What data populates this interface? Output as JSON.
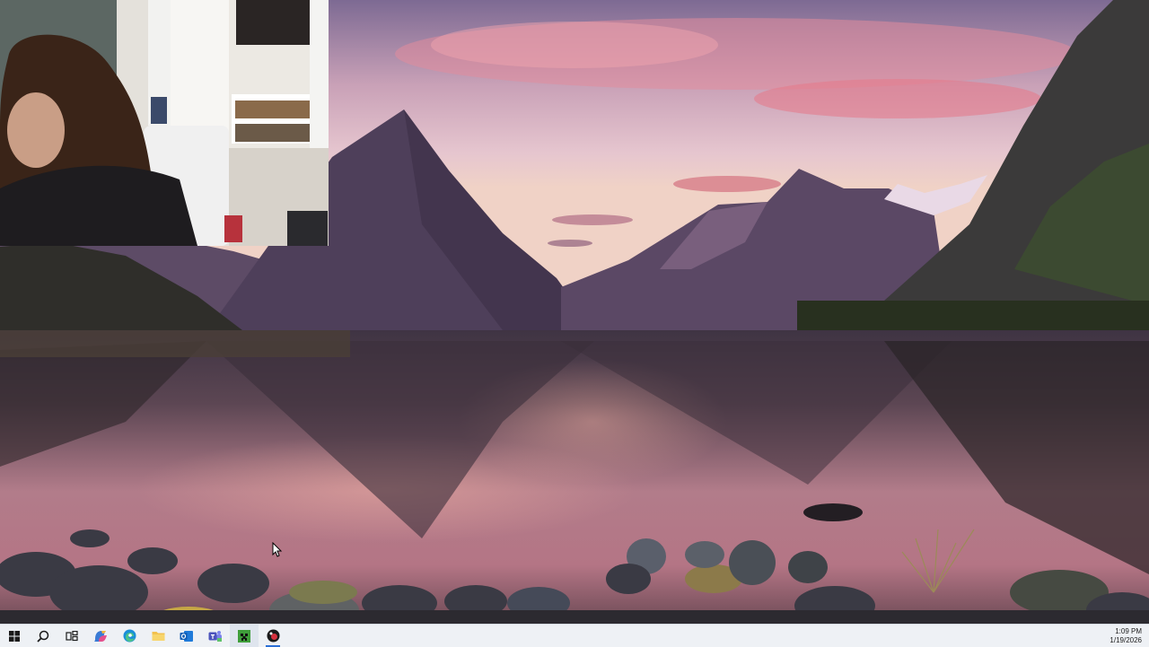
{
  "desktop": {
    "wallpaper": "mountain-lake-sunset"
  },
  "webcam": {
    "subject": "webcam-feed"
  },
  "taskbar": {
    "items": [
      {
        "name": "start-button",
        "icon": "windows-logo-icon"
      },
      {
        "name": "search-button",
        "icon": "search-icon"
      },
      {
        "name": "task-view-button",
        "icon": "task-view-icon"
      },
      {
        "name": "copilot-button",
        "icon": "copilot-icon"
      },
      {
        "name": "edge-button",
        "icon": "edge-icon"
      },
      {
        "name": "file-explorer-button",
        "icon": "folder-icon"
      },
      {
        "name": "outlook-button",
        "icon": "outlook-icon"
      },
      {
        "name": "teams-button",
        "icon": "teams-icon"
      },
      {
        "name": "minecraft-button",
        "icon": "minecraft-icon"
      },
      {
        "name": "recorder-button",
        "icon": "recorder-icon"
      }
    ],
    "clock": {
      "time": "1:09 PM",
      "date": "1/19/2026"
    }
  },
  "colors": {
    "taskbar_bg": "#eef1f5",
    "accent": "#2b6fd6"
  }
}
